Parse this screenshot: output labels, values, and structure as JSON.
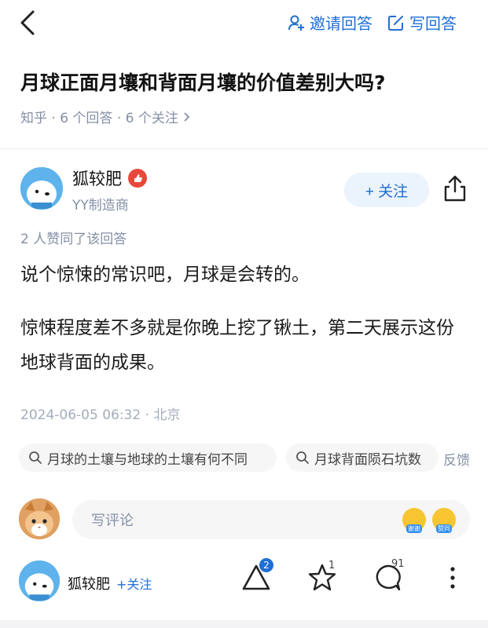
{
  "header": {
    "invite_label": "邀请回答",
    "write_label": "写回答"
  },
  "question": {
    "title": "月球正面月壤和背面月壤的价值差别大吗?",
    "meta": "知乎 · 6 个回答 · 6 个关注"
  },
  "answer": {
    "author_name": "狐较肥",
    "author_title": "YY制造商",
    "follow_label": "+ 关注",
    "likes_text": "2 人赞同了该回答",
    "paragraph1": "说个惊悚的常识吧，月球是会转的。",
    "paragraph2": "惊悚程度差不多就是你晚上挖了锹土，第二天展示这份地球背面的成果。",
    "timestamp": "2024-06-05 06:32 · 北京"
  },
  "related": {
    "chips": [
      {
        "label": "月球的土壤与地球的土壤有何不同"
      },
      {
        "label": "月球背面陨石坑数"
      }
    ],
    "feedback_label": "反馈"
  },
  "comment": {
    "placeholder": "写评论",
    "emoji1_tag": "谢谢",
    "emoji2_tag": "赞同"
  },
  "bottom_bar": {
    "author_name": "狐较肥",
    "follow_label": "+关注",
    "vote_count": "2",
    "favorite_count": "1",
    "comment_count": "91"
  },
  "colors": {
    "accent": "#1f6fd6",
    "muted": "#8590a6"
  }
}
